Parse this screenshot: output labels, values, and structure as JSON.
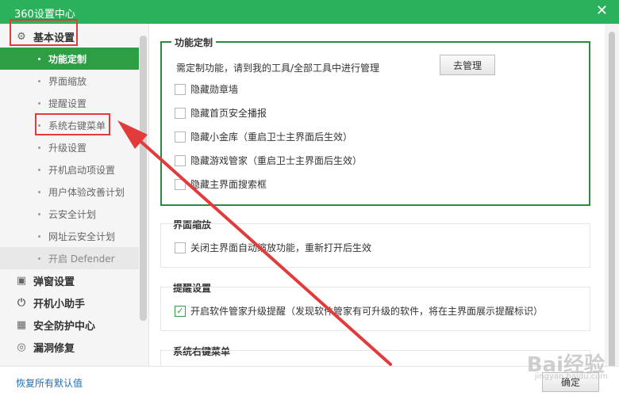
{
  "window": {
    "title": "360设置中心",
    "close_glyph": "✕"
  },
  "sidebar": {
    "group_basic": "基本设置",
    "items": [
      {
        "label": "功能定制"
      },
      {
        "label": "界面缩放"
      },
      {
        "label": "提醒设置"
      },
      {
        "label": "系统右键菜单"
      },
      {
        "label": "升级设置"
      },
      {
        "label": "开机启动项设置"
      },
      {
        "label": "用户体验改善计划"
      },
      {
        "label": "云安全计划"
      },
      {
        "label": "网址云安全计划"
      },
      {
        "label": "开启 Defender"
      }
    ],
    "groups": [
      {
        "label": "弹窗设置",
        "icon": "window-icon"
      },
      {
        "label": "开机小助手",
        "icon": "power-icon"
      },
      {
        "label": "安全防护中心",
        "icon": "grid-icon"
      },
      {
        "label": "漏洞修复",
        "icon": "shield-icon"
      }
    ]
  },
  "main": {
    "custom": {
      "title": "功能定制",
      "desc": "需定制功能，请到我的工具/全部工具中进行管理",
      "manage_button": "去管理",
      "options": [
        {
          "label": "隐藏勋章墙",
          "checked": false
        },
        {
          "label": "隐藏首页安全播报",
          "checked": false
        },
        {
          "label": "隐藏小金库（重启卫士主界面后生效）",
          "checked": false
        },
        {
          "label": "隐藏游戏管家（重启卫士主界面后生效）",
          "checked": false
        },
        {
          "label": "隐藏主界面搜索框",
          "checked": false
        }
      ]
    },
    "zoom": {
      "title": "界面缩放",
      "option": {
        "label": "关闭主界面自动缩放功能，重新打开后生效",
        "checked": false
      }
    },
    "reminder": {
      "title": "提醒设置",
      "option": {
        "label": "开启软件管家升级提醒（发现软件管家有可升级的软件，将在主界面展示提醒标识）",
        "checked": true
      }
    },
    "context_menu": {
      "title": "系统右键菜单"
    }
  },
  "footer": {
    "reset_link": "恢复所有默认值",
    "ok_button": "确定"
  },
  "watermark": {
    "brand": "Bai经验",
    "url": "jingyan.baidu.com"
  },
  "colors": {
    "titlebar": "#2bb15b",
    "active_item": "#2e9e45",
    "annotation": "#e23b3b",
    "link": "#1c6fb8"
  }
}
